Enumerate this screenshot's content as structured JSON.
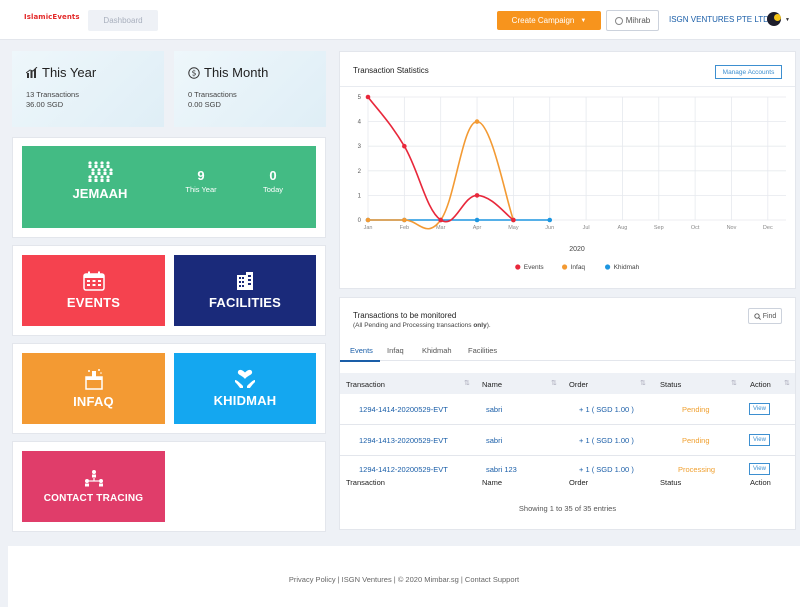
{
  "header": {
    "logo_text": "IslamicEvents",
    "dashboard_tab": "Dashboard",
    "create_campaign": "Create Campaign",
    "mihrab": "Mihrab",
    "org_name": "ISGN VENTURES PTE LTD"
  },
  "stats": {
    "this_year": {
      "title": "This Year",
      "transactions": "13 Transactions",
      "amount": "36.00 SGD"
    },
    "this_month": {
      "title": "This Month",
      "transactions": "0 Transactions",
      "amount": "0.00 SGD"
    }
  },
  "jemaah": {
    "label": "JEMAAH",
    "this_year_value": "9",
    "this_year_label": "This Year",
    "today_value": "0",
    "today_label": "Today"
  },
  "tiles": {
    "events": "EVENTS",
    "facilities": "FACILITIES",
    "infaq": "INFAQ",
    "khidmah": "KHIDMAH",
    "contact_tracing": "CONTACT TRACING"
  },
  "colors": {
    "jemaah": "#43bb84",
    "events": "#f5424f",
    "facilities": "#1a2a7a",
    "infaq": "#f39a33",
    "khidmah": "#14a7f0",
    "contact_tracing": "#e03d6a",
    "create_button": "#f7941d"
  },
  "chart_panel": {
    "title": "Transaction Statistics",
    "manage_accounts": "Manage Accounts"
  },
  "chart_data": {
    "type": "line",
    "xlabel": "2020",
    "ylim": [
      0,
      5
    ],
    "yticks": [
      0,
      1,
      2,
      3,
      4,
      5
    ],
    "categories": [
      "Jan",
      "Feb",
      "Mar",
      "Apr",
      "May",
      "Jun",
      "Jul",
      "Aug",
      "Sep",
      "Oct",
      "Nov",
      "Dec"
    ],
    "legend_position": "bottom",
    "series": [
      {
        "name": "Events",
        "color": "#e8283b",
        "values": [
          5,
          3,
          0,
          1,
          0
        ]
      },
      {
        "name": "Infaq",
        "color": "#f39a33",
        "values": [
          0,
          0,
          0,
          4,
          0
        ]
      },
      {
        "name": "Khidmah",
        "color": "#1e96e0",
        "values": [
          0,
          0,
          0,
          0,
          0,
          0
        ]
      }
    ]
  },
  "transactions": {
    "title": "Transactions",
    "title_suffix": " to be monitored",
    "subtitle_prefix": "(All Pending and Processing transactions ",
    "subtitle_bold": "only",
    "subtitle_suffix": ").",
    "find": "Find",
    "tabs": [
      "Events",
      "Infaq",
      "Khidmah",
      "Facilities"
    ],
    "columns": [
      "Transaction",
      "Name",
      "Order",
      "Status",
      "Action"
    ],
    "rows": [
      {
        "transaction": "1294-1414-20200529-EVT",
        "name": "sabri",
        "order": "+ 1 ( SGD 1.00 )",
        "status": "Pending",
        "action": "View"
      },
      {
        "transaction": "1294-1413-20200529-EVT",
        "name": "sabri",
        "order": "+ 1 ( SGD 1.00 )",
        "status": "Pending",
        "action": "View"
      },
      {
        "transaction": "1294-1412-20200529-EVT",
        "name": "sabri 123",
        "order": "+ 1 ( SGD 1.00 )",
        "status": "Processing",
        "action": "View"
      }
    ],
    "showing": "Showing 1 to 35 of 35 entries"
  },
  "footer": {
    "text": "Privacy Policy | ISGN Ventures | © 2020 Mimbar.sg | Contact Support"
  }
}
